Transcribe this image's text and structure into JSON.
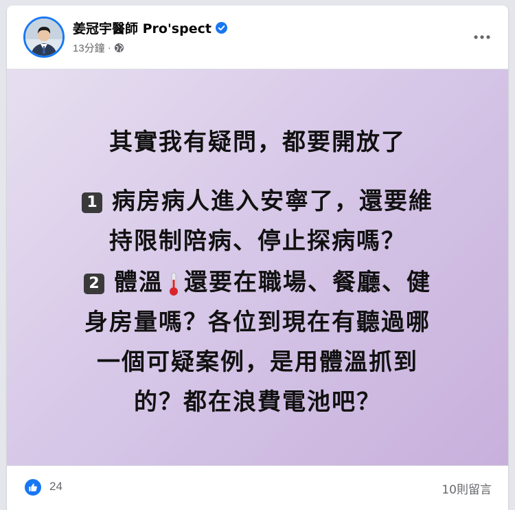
{
  "post": {
    "author": "姜冠宇醫師 Pro'spect",
    "time": "13分鐘",
    "separator": "·",
    "privacy_icon": "globe-icon",
    "verified_icon": "verified-badge-icon",
    "more_icon": "more-options-icon"
  },
  "image_text": {
    "line1": "其實我有疑問，都要開放了",
    "item1_number": "1",
    "line2": "病房病人進入安寧了，還要維",
    "line3": "持限制陪病、停止探病嗎？",
    "item2_number": "2",
    "line4a": "體溫",
    "line4b": "還要在職場、餐廳、健",
    "line5": "身房量嗎？各位到現在有聽過哪",
    "line6": "一個可疑案例，是用體溫抓到",
    "line7": "的？都在浪費電池吧？",
    "thermometer_icon": "thermometer-icon"
  },
  "footer": {
    "like_icon": "like-icon",
    "like_count": "24",
    "comment_count": "10則留言"
  },
  "colors": {
    "accent": "#1877f2",
    "meta_text": "#65676b",
    "image_bg_start": "#e7dff0",
    "image_bg_end": "#c8b0dc"
  }
}
